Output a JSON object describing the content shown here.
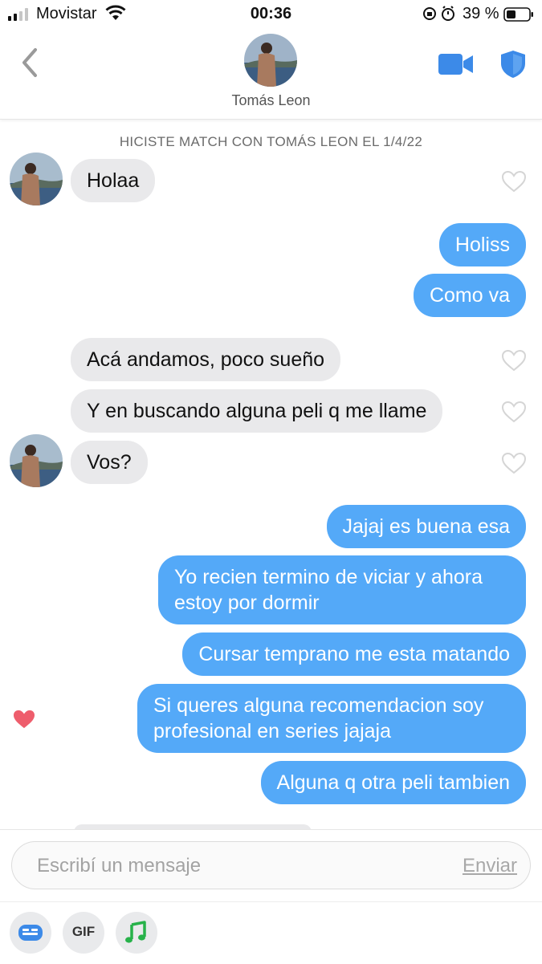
{
  "status": {
    "carrier": "Movistar",
    "time": "00:36",
    "battery": "39 %"
  },
  "header": {
    "name": "Tomás Leon"
  },
  "match_notice": "HICISTE MATCH CON TOMÁS LEON EL 1/4/22",
  "messages": [
    {
      "from": "them",
      "text": "Holaa"
    },
    {
      "from": "me",
      "text": "Holiss"
    },
    {
      "from": "me",
      "text": "Como va"
    },
    {
      "from": "them",
      "text": "Acá andamos, poco sueño"
    },
    {
      "from": "them",
      "text": "Y en buscando alguna peli q me llame"
    },
    {
      "from": "them",
      "text": "Vos?"
    },
    {
      "from": "me",
      "text": "Jajaj es buena esa"
    },
    {
      "from": "me",
      "text": "Yo recien termino de viciar y ahora estoy por dormir"
    },
    {
      "from": "me",
      "text": "Cursar temprano me esta matando"
    },
    {
      "from": "me",
      "text": "Si queres alguna recomendacion soy profesional en series jajaja",
      "liked": true
    },
    {
      "from": "me",
      "text": "Alguna q otra peli tambien"
    }
  ],
  "composer": {
    "placeholder": "Escribí un mensaje",
    "send_label": "Enviar",
    "gif_label": "GIF"
  },
  "colors": {
    "outgoing": "#54a9f8",
    "incoming": "#e9e9eb",
    "like": "#ee5d6c",
    "accent": "#3c8ae8"
  }
}
